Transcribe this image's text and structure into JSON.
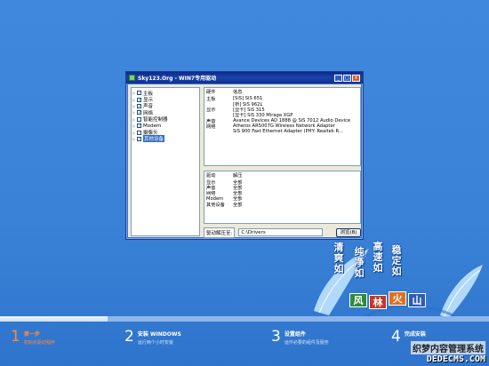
{
  "window": {
    "title": "Sky123.Org - WIN7专用驱动",
    "minimize": "_",
    "maximize": "□",
    "close": "×"
  },
  "tree": [
    {
      "label": "主板",
      "checked": false
    },
    {
      "label": "显示",
      "checked": true
    },
    {
      "label": "声音",
      "checked": true
    },
    {
      "label": "网络",
      "checked": true
    },
    {
      "label": "智能控制器",
      "checked": false
    },
    {
      "label": "Modem",
      "checked": true
    },
    {
      "label": "摄像头",
      "checked": false
    },
    {
      "label": "其他设备",
      "checked": true,
      "selected": true
    }
  ],
  "info_pane": {
    "header": {
      "k": "硬件",
      "v": "信息"
    },
    "rows": [
      {
        "k": "主板",
        "v": "[SiS] SiS 651"
      },
      {
        "k": "",
        "v": "[桥] SiS 962L"
      },
      {
        "k": "显示",
        "v": "[显卡] SiS 315"
      },
      {
        "k": "",
        "v": "[显卡] SiS 330 Mirage XGP"
      },
      {
        "k": "声音",
        "v": "Avance Devices AD 1888 @ SiS 7012 Audio Device"
      },
      {
        "k": "网络",
        "v": "Atheros AR5007G Wireless Network Adapter"
      },
      {
        "k": "",
        "v": "SiS 900 Fast Ethernet Adapter (PHY: Realtek R..."
      }
    ]
  },
  "driver_pane": {
    "header": {
      "k": "驱动",
      "v": "解压"
    },
    "rows": [
      {
        "k": "显示",
        "v": "全部"
      },
      {
        "k": "声音",
        "v": "全部"
      },
      {
        "k": "网络",
        "v": "全部"
      },
      {
        "k": "Modem",
        "v": "全部"
      },
      {
        "k": "其他设备",
        "v": "全部"
      }
    ]
  },
  "path": {
    "label": "驱动解压至:",
    "value": "C:\\Drivers",
    "browse": "浏览(B)"
  },
  "logo": {
    "slogans": [
      "清爽如",
      "纯净如",
      "高速如",
      "稳定如"
    ],
    "brand": [
      "风",
      "林",
      "火",
      "山"
    ]
  },
  "progress": {
    "fraction": 0.22
  },
  "steps": [
    {
      "num": "1",
      "title": "第一步",
      "sub": "初始化驱动程序",
      "active": true
    },
    {
      "num": "2",
      "title": "安装 WINDOWS",
      "sub": "运行两个小时安装",
      "active": false
    },
    {
      "num": "3",
      "title": "设置组件",
      "sub": "运作必要的组件及服务",
      "active": false
    },
    {
      "num": "4",
      "title": "完成安装",
      "sub": "",
      "active": false
    }
  ],
  "watermark": {
    "cn": "织梦内容管理系统",
    "en": "DEDECMS.COM"
  },
  "colors": {
    "background": "#3a82d8",
    "active_step": "#ff8a3a",
    "logo_tiles": [
      "#2f8a3a",
      "#c0392b",
      "#e07020",
      "#2a5cb8"
    ]
  }
}
